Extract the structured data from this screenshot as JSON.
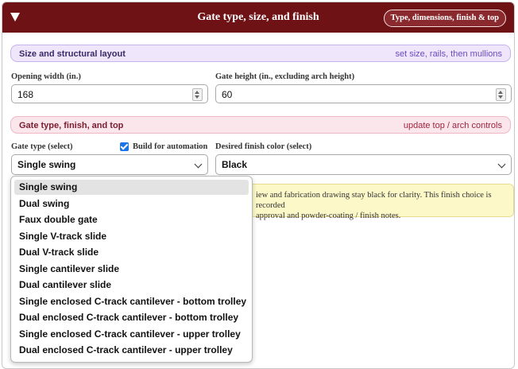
{
  "header": {
    "title": "Gate type, size, and finish",
    "pill": "Type, dimensions, finish & top"
  },
  "size_section": {
    "title": "Size and structural layout",
    "hint": "set size, rails, then mullions"
  },
  "opening_width": {
    "label": "Opening width (in.)",
    "value": "168"
  },
  "gate_height": {
    "label": "Gate height (in., excluding arch height)",
    "value": "60"
  },
  "type_section": {
    "title": "Gate type, finish, and top",
    "hint": "update top / arch controls"
  },
  "gate_type": {
    "label": "Gate type (select)",
    "value": "Single swing",
    "options": [
      "Single swing",
      "Dual swing",
      "Faux double gate",
      "Single V-track slide",
      "Dual V-track slide",
      "Single cantilever slide",
      "Dual cantilever slide",
      "Single enclosed C-track cantilever - bottom trolley",
      "Dual enclosed C-track cantilever - bottom trolley",
      "Single enclosed C-track cantilever - upper trolley",
      "Dual enclosed C-track cantilever - upper trolley"
    ]
  },
  "automation": {
    "label": "Build for automation",
    "checked": true
  },
  "finish_color": {
    "label": "Desired finish color (select)",
    "value": "Black"
  },
  "note": {
    "line1": "iew and fabrication drawing stay black for clarity. This finish choice is recorded",
    "line2": "approval and powder-coating / finish notes."
  }
}
